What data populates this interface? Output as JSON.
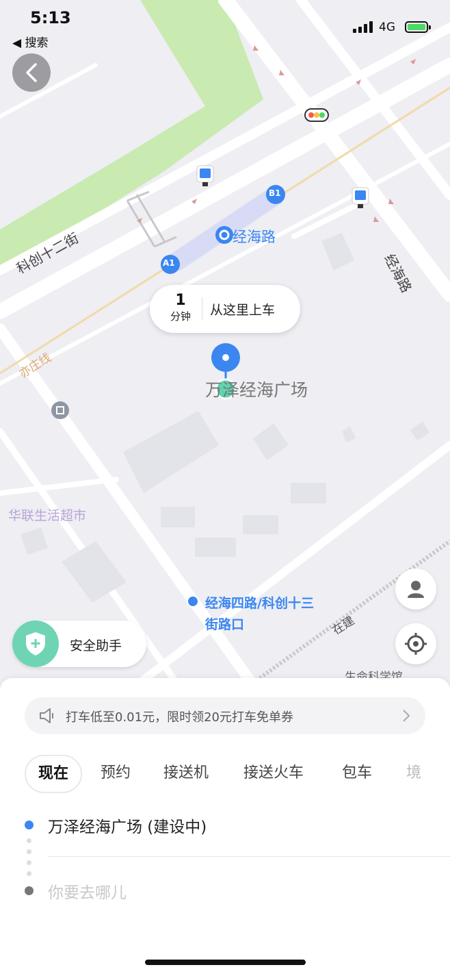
{
  "status_bar": {
    "time": "5:13",
    "back_app": "◀ 搜索",
    "network": "4G"
  },
  "map": {
    "station_name": "经海路",
    "exit_a1": "A1",
    "exit_b1": "B1",
    "street_kechuang12": "科创十二街",
    "street_jinghai": "经海路",
    "rail_line": "亦庄线",
    "place_wanze": "万泽经海广场",
    "place_hualian": "华联生活超市",
    "poi_intersection_line1": "经海四路/科创十三",
    "poi_intersection_line2": "街路口",
    "under_construction": "在建",
    "place_life_science": "生命科学馆"
  },
  "pickup_bubble": {
    "eta_value": "1",
    "eta_unit": "分钟",
    "text": "从这里上车"
  },
  "safety": {
    "label": "安全助手"
  },
  "promo": {
    "text": "打车低至0.01元，限时领20元打车免单券"
  },
  "tabs": [
    {
      "label": "现在"
    },
    {
      "label": "预约"
    },
    {
      "label": "接送机"
    },
    {
      "label": "接送火车"
    },
    {
      "label": "包车"
    },
    {
      "label": "境"
    }
  ],
  "route": {
    "from": "万泽经海广场 (建设中)",
    "to_placeholder": "你要去哪儿"
  },
  "colors": {
    "accent_blue": "#3b86f0",
    "safety_green": "#6fd4b4",
    "park_green": "#c9eab0"
  },
  "icons": [
    "back-arrow-icon",
    "bus-stop-icon",
    "metro-icon",
    "traffic-light-icon",
    "location-pin-icon",
    "user-icon",
    "locate-icon",
    "shield-plus-icon",
    "speaker-icon",
    "chevron-right-icon"
  ]
}
